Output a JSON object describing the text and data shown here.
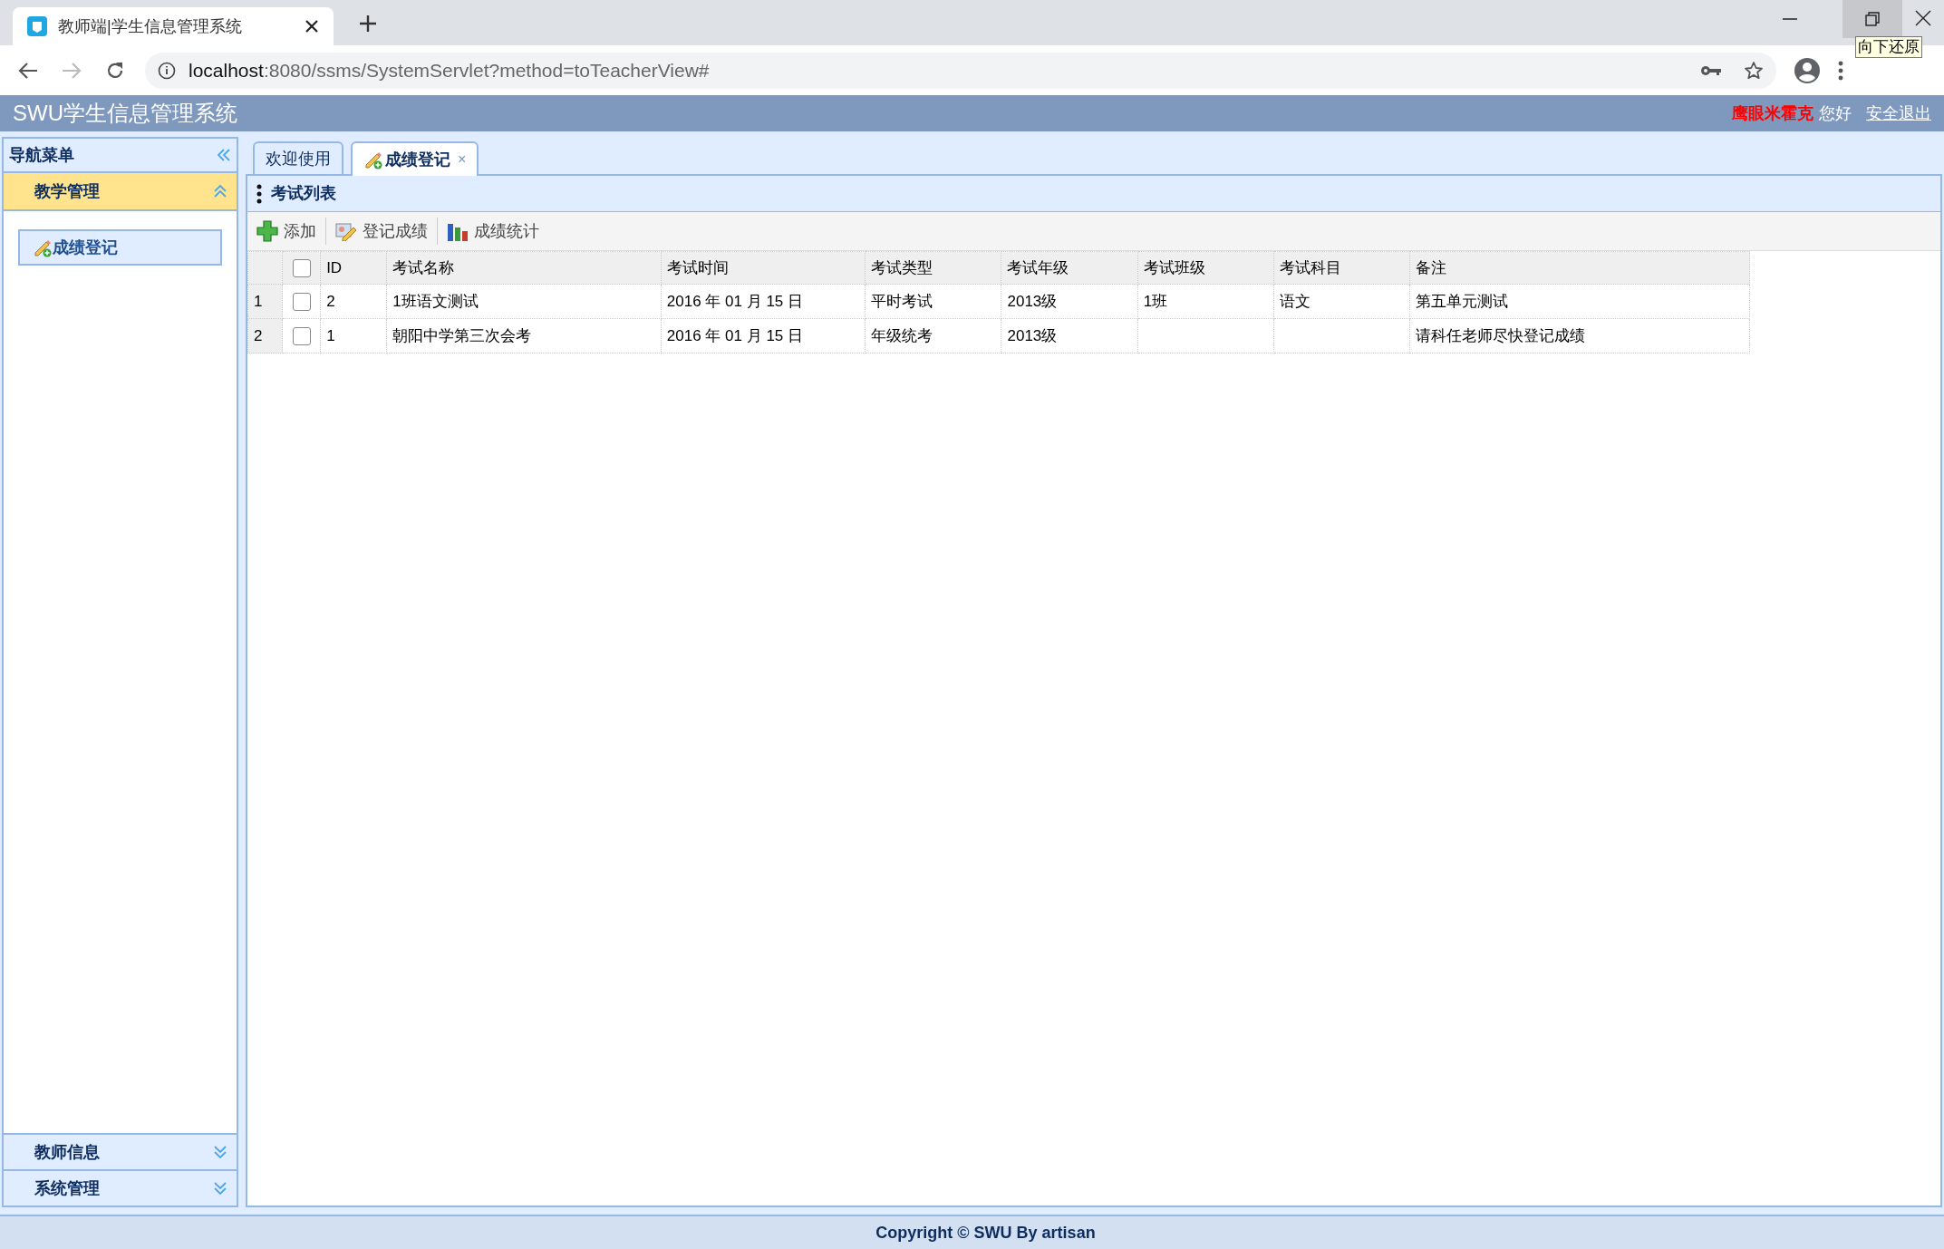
{
  "browser": {
    "tab_title": "教师端|学生信息管理系统",
    "url_host": "localhost",
    "url_rest": ":8080/ssms/SystemServlet?method=toTeacherView#",
    "tooltip": "向下还原"
  },
  "header": {
    "title": "SWU学生信息管理系统",
    "user": "鹰眼米霍克",
    "greeting": "您好",
    "logout": "安全退出"
  },
  "sidebar": {
    "title": "导航菜单",
    "sections": [
      {
        "label": "教学管理",
        "expanded": true,
        "items": [
          {
            "label": "成绩登记",
            "selected": true
          }
        ]
      },
      {
        "label": "教师信息",
        "expanded": false
      },
      {
        "label": "系统管理",
        "expanded": false
      }
    ]
  },
  "tabs": [
    {
      "label": "欢迎使用",
      "selected": false,
      "closable": false
    },
    {
      "label": "成绩登记",
      "selected": true,
      "closable": true,
      "close": "×"
    }
  ],
  "panel": {
    "title": "考试列表",
    "toolbar": [
      {
        "label": "添加",
        "kind": "add"
      },
      {
        "label": "登记成绩",
        "kind": "edit"
      },
      {
        "label": "成绩统计",
        "kind": "chart"
      }
    ],
    "table": {
      "select_all_checked": false,
      "columns": [
        "ID",
        "考试名称",
        "考试时间",
        "考试类型",
        "考试年级",
        "考试班级",
        "考试科目",
        "备注"
      ],
      "rows": [
        {
          "number": "1",
          "checked": false,
          "cells": [
            "2",
            "1班语文测试",
            "2016 年 01 月 15 日",
            "平时考试",
            "2013级",
            "1班",
            "语文",
            "第五单元测试"
          ]
        },
        {
          "number": "2",
          "checked": false,
          "cells": [
            "1",
            "朝阳中学第三次会考",
            "2016 年 01 月 15 日",
            "年级统考",
            "2013级",
            "",
            "",
            "请科任老师尽快登记成绩"
          ]
        }
      ]
    }
  },
  "footer": "Copyright © SWU By artisan"
}
